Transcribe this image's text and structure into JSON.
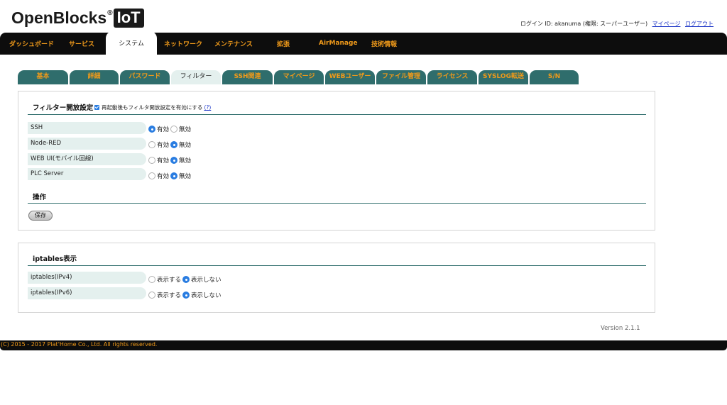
{
  "logo": {
    "name": "OpenBlocks",
    "reg": "®",
    "badge": "IoT"
  },
  "userbar": {
    "login_text": "ログイン ID: akanuma (権限: スーパーユーザー)",
    "mypage_link": "マイページ",
    "logout_link": "ログアウト"
  },
  "nav": {
    "items": [
      "ダッシュボード",
      "サービス",
      "システム",
      "ネットワーク",
      "メンテナンス",
      "拡張",
      "AirManage",
      "技術情報"
    ],
    "active": "システム"
  },
  "subtabs": {
    "items": [
      "基本",
      "詳細",
      "パスワード",
      "フィルター",
      "SSH関連",
      "マイページ",
      "WEBユーザー",
      "ファイル管理",
      "ライセンス",
      "SYSLOG転送",
      "S/N"
    ],
    "active": "フィルター"
  },
  "filter_section": {
    "title": "フィルター開放設定",
    "persist_checkbox_label": "再起動後もフィルタ開放設定を有効にする",
    "persist_checked": true,
    "help_link": "?",
    "enabled_label": "有効",
    "disabled_label": "無効",
    "rows": [
      {
        "label": "SSH",
        "value": "有効"
      },
      {
        "label": "Node-RED",
        "value": "無効"
      },
      {
        "label": "WEB UI(モバイル回線)",
        "value": "無効"
      },
      {
        "label": "PLC Server",
        "value": "無効"
      }
    ]
  },
  "operation_section": {
    "title": "操作",
    "save_button": "保存"
  },
  "iptables_section": {
    "title": "iptables表示",
    "show_label": "表示する",
    "hide_label": "表示しない",
    "rows": [
      {
        "label": "iptables(IPv4)",
        "value": "表示しない"
      },
      {
        "label": "iptables(IPv6)",
        "value": "表示しない"
      }
    ]
  },
  "version": "Version 2.1.1",
  "footer": "(C) 2015 - 2017 Plat'Home Co., Ltd. All rights reserved.",
  "colors": {
    "accent_orange": "#f09a1a",
    "teal": "#2f6d6c",
    "light_teal": "#e4f0ee",
    "radio_blue": "#2a7de1",
    "bar_black": "#0d0d0d"
  }
}
